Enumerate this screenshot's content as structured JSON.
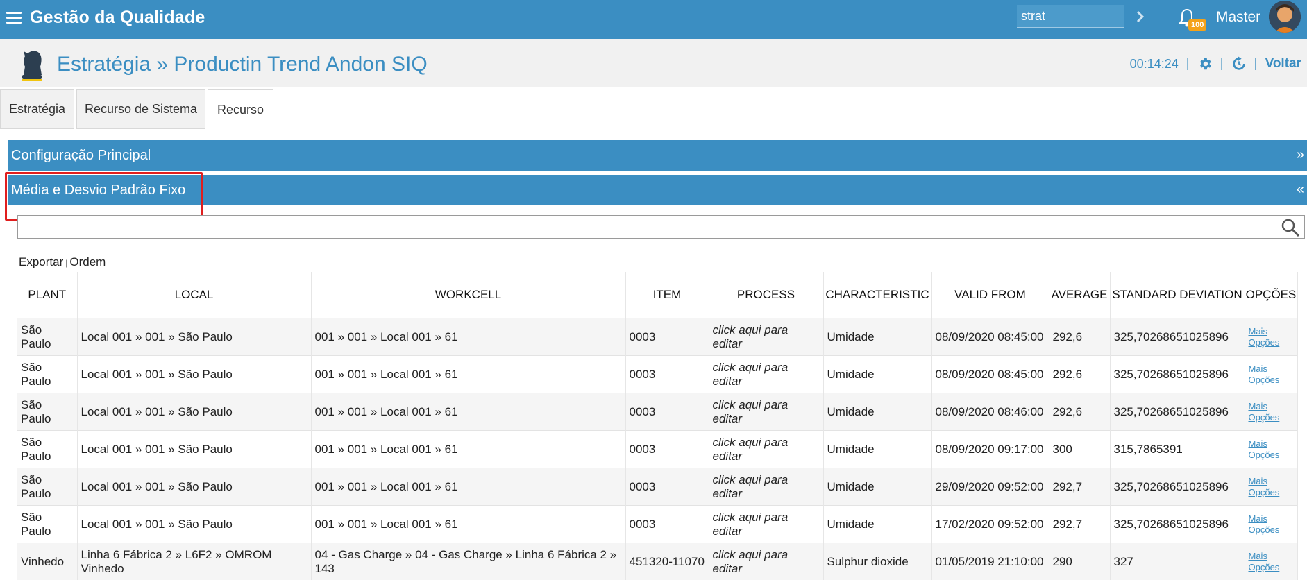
{
  "app": {
    "title": "Gestão da Qualidade"
  },
  "topbar": {
    "search_value": "strat",
    "notification_count": "100",
    "user_name": "Master"
  },
  "header": {
    "title": "Estratégia » Productin Trend Andon SIQ",
    "timer": "00:14:24",
    "back_label": "Voltar"
  },
  "tabs": [
    {
      "label": "Estratégia"
    },
    {
      "label": "Recurso de Sistema"
    },
    {
      "label": "Recurso"
    }
  ],
  "panels": {
    "main_config": {
      "label": "Configuração Principal",
      "arrow": "»"
    },
    "fixed_avg": {
      "label": "Média e Desvio Padrão Fixo",
      "arrow": "«"
    }
  },
  "actions": {
    "export": "Exportar",
    "order": "Ordem"
  },
  "table": {
    "columns": [
      "PLANT",
      "LOCAL",
      "WORKCELL",
      "ITEM",
      "PROCESS",
      "CHARACTERISTIC",
      "VALID FROM",
      "AVERAGE",
      "STANDARD DEVIATION",
      "OPÇÕES"
    ],
    "more_label_1": "Mais",
    "more_label_2": "Opções",
    "rows": [
      {
        "plant": "São Paulo",
        "local": "Local 001 » 001 » São Paulo",
        "workcell": "001 » 001 » Local 001 » 61",
        "item": "0003",
        "process": "click aqui para editar",
        "characteristic": "Umidade",
        "valid_from": "08/09/2020 08:45:00",
        "average": "292,6",
        "std_dev": "325,70268651025896"
      },
      {
        "plant": "São Paulo",
        "local": "Local 001 » 001 » São Paulo",
        "workcell": "001 » 001 » Local 001 » 61",
        "item": "0003",
        "process": "click aqui para editar",
        "characteristic": "Umidade",
        "valid_from": "08/09/2020 08:45:00",
        "average": "292,6",
        "std_dev": "325,70268651025896"
      },
      {
        "plant": "São Paulo",
        "local": "Local 001 » 001 » São Paulo",
        "workcell": "001 » 001 » Local 001 » 61",
        "item": "0003",
        "process": "click aqui para editar",
        "characteristic": "Umidade",
        "valid_from": "08/09/2020 08:46:00",
        "average": "292,6",
        "std_dev": "325,70268651025896"
      },
      {
        "plant": "São Paulo",
        "local": "Local 001 » 001 » São Paulo",
        "workcell": "001 » 001 » Local 001 » 61",
        "item": "0003",
        "process": "click aqui para editar",
        "characteristic": "Umidade",
        "valid_from": "08/09/2020 09:17:00",
        "average": "300",
        "std_dev": "315,7865391"
      },
      {
        "plant": "São Paulo",
        "local": "Local 001 » 001 » São Paulo",
        "workcell": "001 » 001 » Local 001 » 61",
        "item": "0003",
        "process": "click aqui para editar",
        "characteristic": "Umidade",
        "valid_from": "29/09/2020 09:52:00",
        "average": "292,7",
        "std_dev": "325,70268651025896"
      },
      {
        "plant": "São Paulo",
        "local": "Local 001 » 001 » São Paulo",
        "workcell": "001 » 001 » Local 001 » 61",
        "item": "0003",
        "process": "click aqui para editar",
        "characteristic": "Umidade",
        "valid_from": "17/02/2020 09:52:00",
        "average": "292,7",
        "std_dev": "325,70268651025896"
      },
      {
        "plant": "Vinhedo",
        "local": "Linha 6 Fábrica 2 » L6F2 » OMROM Vinhedo",
        "workcell": "04 - Gas Charge » 04 - Gas Charge » Linha 6 Fábrica 2 » 143",
        "item": "451320-11070",
        "process": "click aqui para editar",
        "characteristic": "Sulphur dioxide",
        "valid_from": "01/05/2019 21:10:00",
        "average": "290",
        "std_dev": "327"
      }
    ]
  },
  "colors": {
    "primary": "#3b8ec2",
    "highlight": "#e01e1e",
    "badge": "#f4a21a"
  },
  "icons": [
    "menu-icon",
    "chevron-right-icon",
    "bell-icon",
    "avatar",
    "knight-icon",
    "gear-icon",
    "refresh-icon",
    "search-icon"
  ]
}
